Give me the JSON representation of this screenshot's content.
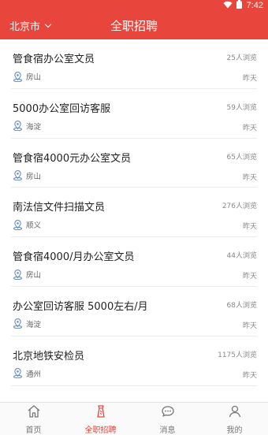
{
  "status_bar": {
    "time": "7:42"
  },
  "header": {
    "city": "北京市",
    "title": "全职招聘"
  },
  "jobs": [
    {
      "title": "管食宿办公室文员",
      "views": "25人浏览",
      "location": "房山",
      "date": "昨天"
    },
    {
      "title": "5000办公室回访客服",
      "views": "59人浏览",
      "location": "海淀",
      "date": "昨天"
    },
    {
      "title": "管食宿4000元办公室文员",
      "views": "65人浏览",
      "location": "房山",
      "date": "昨天"
    },
    {
      "title": "南法信文件扫描文员",
      "views": "276人浏览",
      "location": "顺义",
      "date": "昨天"
    },
    {
      "title": "管食宿4000/月办公室文员",
      "views": "44人浏览",
      "location": "房山",
      "date": "昨天"
    },
    {
      "title": "办公室回访客服 5000左右/月",
      "views": "68人浏览",
      "location": "海淀",
      "date": "昨天"
    },
    {
      "title": "北京地铁安检员",
      "views": "1175人浏览",
      "location": "通州",
      "date": "昨天"
    }
  ],
  "tabbar": {
    "tabs": [
      {
        "label": "首页",
        "icon": "home-icon"
      },
      {
        "label": "全职招聘",
        "icon": "shirt-icon",
        "active": true
      },
      {
        "label": "消息",
        "icon": "chat-icon"
      },
      {
        "label": "我的",
        "icon": "user-icon"
      }
    ]
  },
  "colors": {
    "accent": "#e8463d"
  }
}
